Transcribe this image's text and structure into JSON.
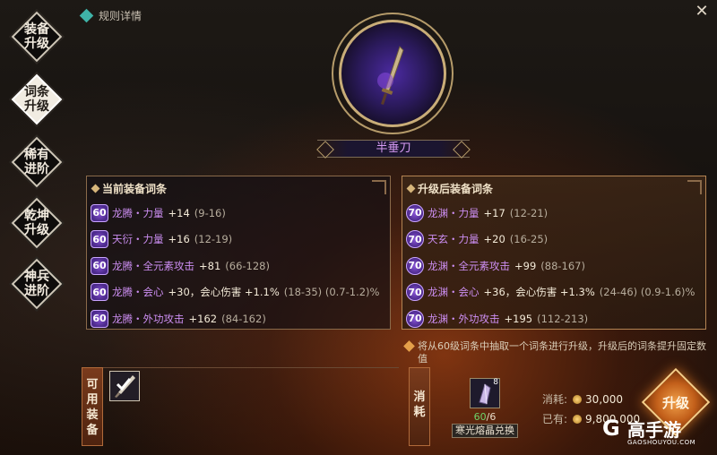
{
  "nav": {
    "items": [
      {
        "label": "装备\n升级",
        "active": false
      },
      {
        "label": "词条\n升级",
        "active": true
      },
      {
        "label": "稀有\n进阶",
        "active": false
      },
      {
        "label": "乾坤\n升级",
        "active": false
      },
      {
        "label": "神兵\n进阶",
        "active": false
      }
    ]
  },
  "header": {
    "rules_label": "规则详情",
    "close_glyph": "✕"
  },
  "item": {
    "name": "半垂刀"
  },
  "current_panel": {
    "title": "当前装备词条",
    "rows": [
      {
        "level": "60",
        "attr": "龙腾・力量",
        "value": "+14",
        "range": "(9-16)"
      },
      {
        "level": "60",
        "attr": "天衍・力量",
        "value": "+16",
        "range": "(12-19)"
      },
      {
        "level": "60",
        "attr": "龙腾・全元素攻击",
        "value": "+81",
        "range": "(66-128)"
      },
      {
        "level": "60",
        "attr": "龙腾・会心",
        "value": "+30，会心伤害 +1.1%",
        "range": "(18-35) (0.7-1.2)%"
      },
      {
        "level": "60",
        "attr": "龙腾・外功攻击",
        "value": "+162",
        "range": "(84-162)"
      }
    ]
  },
  "upgraded_panel": {
    "title": "升级后装备词条",
    "rows": [
      {
        "level": "70",
        "attr": "龙渊・力量",
        "value": "+17",
        "range": "(12-21)"
      },
      {
        "level": "70",
        "attr": "天玄・力量",
        "value": "+20",
        "range": "(16-25)"
      },
      {
        "level": "70",
        "attr": "龙渊・全元素攻击",
        "value": "+99",
        "range": "(88-167)"
      },
      {
        "level": "70",
        "attr": "龙渊・会心",
        "value": "+36，会心伤害 +1.3%",
        "range": "(24-46) (0.9-1.6)%"
      },
      {
        "level": "70",
        "attr": "龙渊・外功攻击",
        "value": "+195",
        "range": "(112-213)"
      }
    ]
  },
  "note": "将从60级词条中抽取一个词条进行升级，升级后的词条提升固定数值",
  "available": {
    "label": "可用装备"
  },
  "consume": {
    "label": "消耗",
    "crystal_badge": "8",
    "have": "60",
    "need": "/6",
    "exchange_label": "寒光熔晶兑换",
    "cost_label": "消耗:",
    "cost_value": "30,000",
    "owned_label": "已有:",
    "owned_value": "9,800,000"
  },
  "upgrade_button": "升级",
  "watermark": {
    "brand": "高手游",
    "sub": "GAOSHOUYOU.COM"
  }
}
